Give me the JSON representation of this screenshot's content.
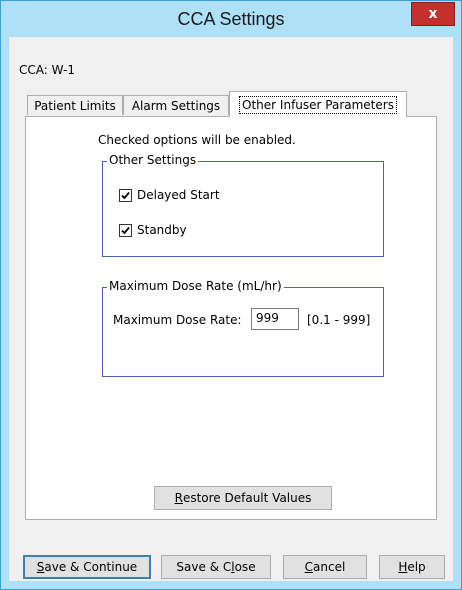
{
  "window": {
    "title": "CCA Settings",
    "close_label": "x"
  },
  "cca": {
    "label": "CCA: W-1"
  },
  "tabs": [
    {
      "label": "Patient Limits",
      "active": false
    },
    {
      "label": "Alarm Settings",
      "active": false
    },
    {
      "label": "Other Infuser Parameters",
      "active": true
    }
  ],
  "panel": {
    "hint": "Checked options will be enabled.",
    "other_settings": {
      "title": "Other Settings",
      "options": [
        {
          "label": "Delayed Start",
          "checked": true
        },
        {
          "label": "Standby",
          "checked": true
        }
      ]
    },
    "max_dose": {
      "title": "Maximum Dose Rate (mL/hr)",
      "field_label": "Maximum Dose Rate:",
      "value": "999",
      "range": "[0.1 - 999]"
    },
    "restore": {
      "mnemonic": "R",
      "rest": "estore Default Values"
    }
  },
  "footer": {
    "save_continue": {
      "mnemonic": "S",
      "rest": "ave & Continue"
    },
    "save_close": {
      "before": "Save & C",
      "mnemonic": "l",
      "after": "ose"
    },
    "cancel": {
      "mnemonic": "C",
      "rest": "ancel"
    },
    "help": {
      "mnemonic": "H",
      "rest": "elp"
    }
  }
}
